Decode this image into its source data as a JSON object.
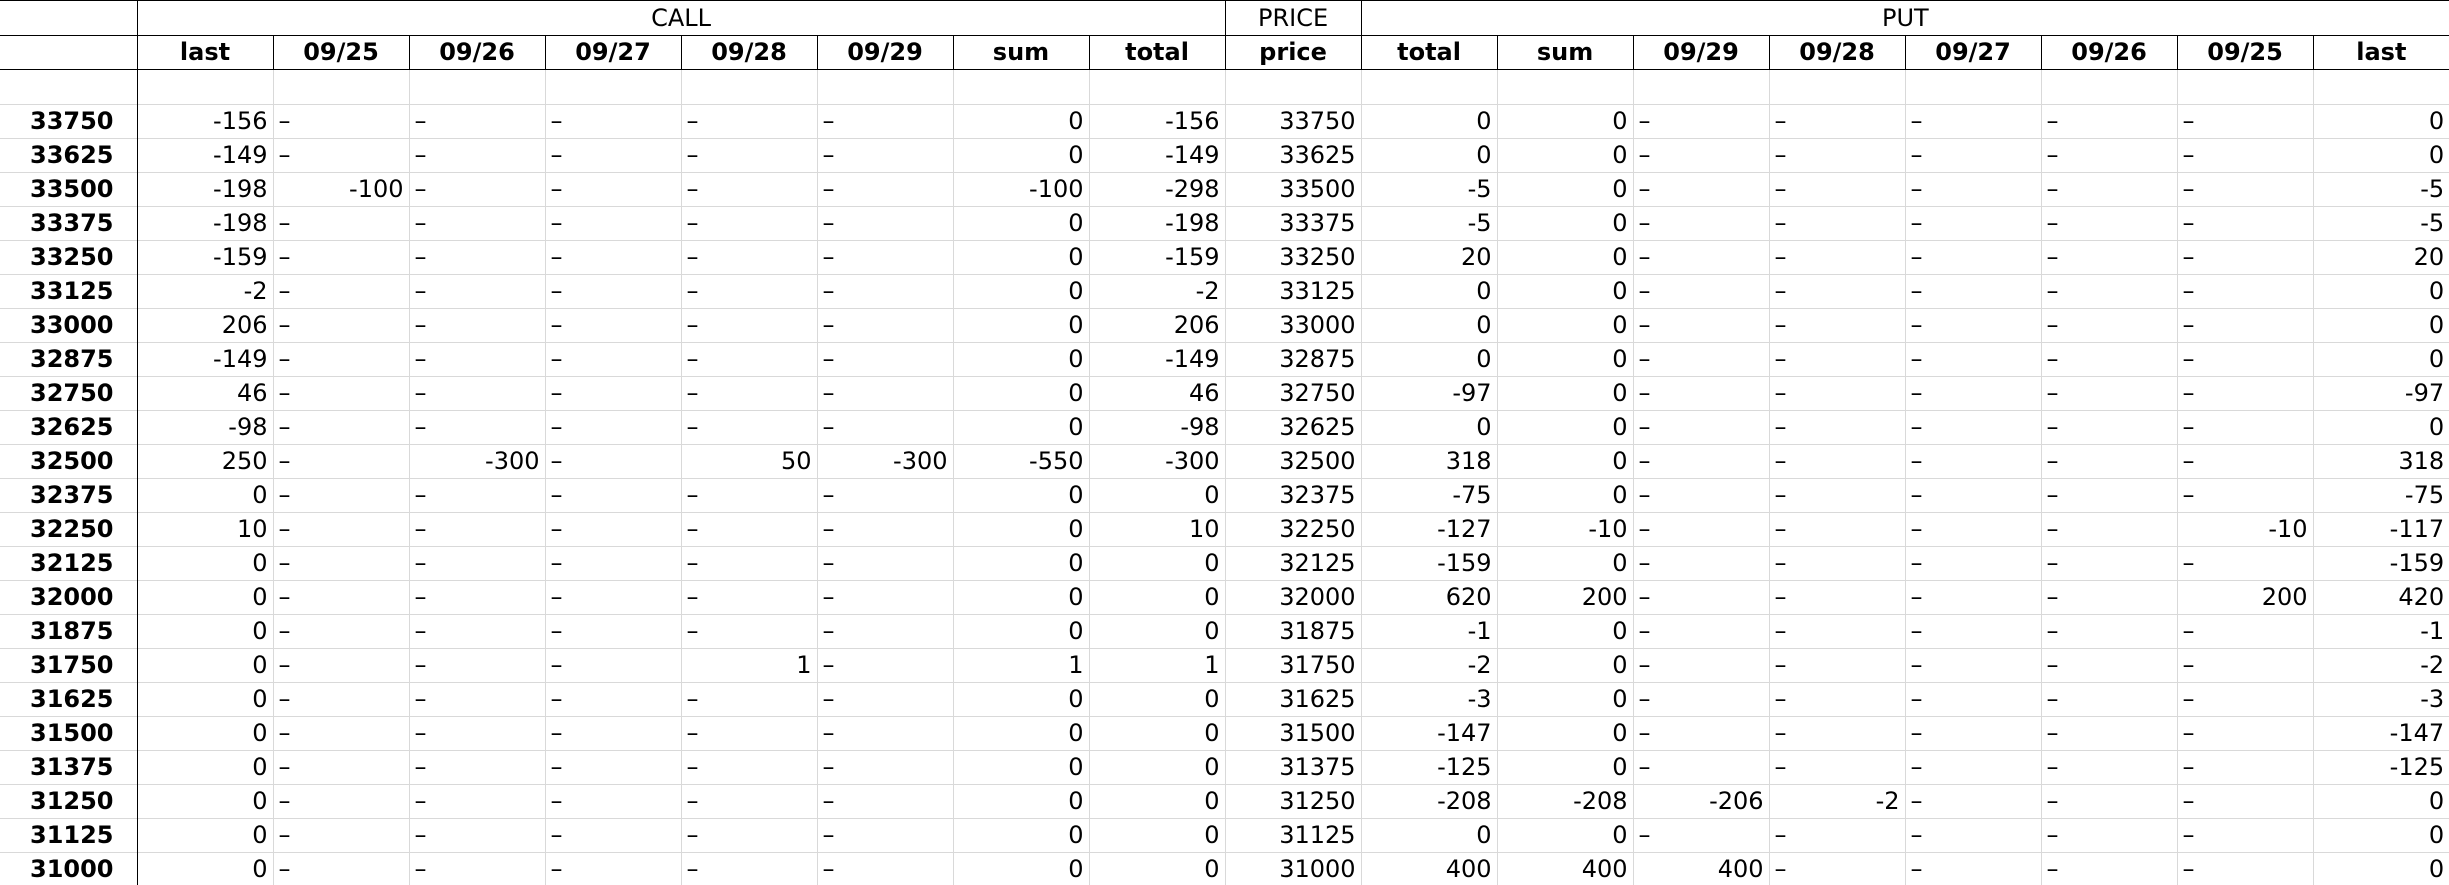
{
  "groups": {
    "call": "CALL",
    "price": "PRICE",
    "put": "PUT"
  },
  "headers": {
    "call": [
      "last",
      "09/25",
      "09/26",
      "09/27",
      "09/28",
      "09/29",
      "sum",
      "total"
    ],
    "price": "price",
    "put": [
      "total",
      "sum",
      "09/29",
      "09/28",
      "09/27",
      "09/26",
      "09/25",
      "last"
    ]
  },
  "rows": [
    {
      "label": "33750",
      "call": [
        "-156",
        "–",
        "–",
        "–",
        "–",
        "–",
        "0",
        "-156"
      ],
      "price": "33750",
      "put": [
        "0",
        "0",
        "–",
        "–",
        "–",
        "–",
        "–",
        "0"
      ]
    },
    {
      "label": "33625",
      "call": [
        "-149",
        "–",
        "–",
        "–",
        "–",
        "–",
        "0",
        "-149"
      ],
      "price": "33625",
      "put": [
        "0",
        "0",
        "–",
        "–",
        "–",
        "–",
        "–",
        "0"
      ]
    },
    {
      "label": "33500",
      "call": [
        "-198",
        "-100",
        "–",
        "–",
        "–",
        "–",
        "-100",
        "-298"
      ],
      "price": "33500",
      "put": [
        "-5",
        "0",
        "–",
        "–",
        "–",
        "–",
        "–",
        "-5"
      ]
    },
    {
      "label": "33375",
      "call": [
        "-198",
        "–",
        "–",
        "–",
        "–",
        "–",
        "0",
        "-198"
      ],
      "price": "33375",
      "put": [
        "-5",
        "0",
        "–",
        "–",
        "–",
        "–",
        "–",
        "-5"
      ]
    },
    {
      "label": "33250",
      "call": [
        "-159",
        "–",
        "–",
        "–",
        "–",
        "–",
        "0",
        "-159"
      ],
      "price": "33250",
      "put": [
        "20",
        "0",
        "–",
        "–",
        "–",
        "–",
        "–",
        "20"
      ]
    },
    {
      "label": "33125",
      "call": [
        "-2",
        "–",
        "–",
        "–",
        "–",
        "–",
        "0",
        "-2"
      ],
      "price": "33125",
      "put": [
        "0",
        "0",
        "–",
        "–",
        "–",
        "–",
        "–",
        "0"
      ]
    },
    {
      "label": "33000",
      "call": [
        "206",
        "–",
        "–",
        "–",
        "–",
        "–",
        "0",
        "206"
      ],
      "price": "33000",
      "put": [
        "0",
        "0",
        "–",
        "–",
        "–",
        "–",
        "–",
        "0"
      ]
    },
    {
      "label": "32875",
      "call": [
        "-149",
        "–",
        "–",
        "–",
        "–",
        "–",
        "0",
        "-149"
      ],
      "price": "32875",
      "put": [
        "0",
        "0",
        "–",
        "–",
        "–",
        "–",
        "–",
        "0"
      ]
    },
    {
      "label": "32750",
      "call": [
        "46",
        "–",
        "–",
        "–",
        "–",
        "–",
        "0",
        "46"
      ],
      "price": "32750",
      "put": [
        "-97",
        "0",
        "–",
        "–",
        "–",
        "–",
        "–",
        "-97"
      ]
    },
    {
      "label": "32625",
      "call": [
        "-98",
        "–",
        "–",
        "–",
        "–",
        "–",
        "0",
        "-98"
      ],
      "price": "32625",
      "put": [
        "0",
        "0",
        "–",
        "–",
        "–",
        "–",
        "–",
        "0"
      ]
    },
    {
      "label": "32500",
      "call": [
        "250",
        "–",
        "-300",
        "–",
        "50",
        "-300",
        "-550",
        "-300"
      ],
      "price": "32500",
      "put": [
        "318",
        "0",
        "–",
        "–",
        "–",
        "–",
        "–",
        "318"
      ]
    },
    {
      "label": "32375",
      "call": [
        "0",
        "–",
        "–",
        "–",
        "–",
        "–",
        "0",
        "0"
      ],
      "price": "32375",
      "put": [
        "-75",
        "0",
        "–",
        "–",
        "–",
        "–",
        "–",
        "-75"
      ]
    },
    {
      "label": "32250",
      "call": [
        "10",
        "–",
        "–",
        "–",
        "–",
        "–",
        "0",
        "10"
      ],
      "price": "32250",
      "put": [
        "-127",
        "-10",
        "–",
        "–",
        "–",
        "–",
        "-10",
        "-117"
      ]
    },
    {
      "label": "32125",
      "call": [
        "0",
        "–",
        "–",
        "–",
        "–",
        "–",
        "0",
        "0"
      ],
      "price": "32125",
      "put": [
        "-159",
        "0",
        "–",
        "–",
        "–",
        "–",
        "–",
        "-159"
      ]
    },
    {
      "label": "32000",
      "call": [
        "0",
        "–",
        "–",
        "–",
        "–",
        "–",
        "0",
        "0"
      ],
      "price": "32000",
      "put": [
        "620",
        "200",
        "–",
        "–",
        "–",
        "–",
        "200",
        "420"
      ]
    },
    {
      "label": "31875",
      "call": [
        "0",
        "–",
        "–",
        "–",
        "–",
        "–",
        "0",
        "0"
      ],
      "price": "31875",
      "put": [
        "-1",
        "0",
        "–",
        "–",
        "–",
        "–",
        "–",
        "-1"
      ]
    },
    {
      "label": "31750",
      "call": [
        "0",
        "–",
        "–",
        "–",
        "1",
        "–",
        "1",
        "1"
      ],
      "price": "31750",
      "put": [
        "-2",
        "0",
        "–",
        "–",
        "–",
        "–",
        "–",
        "-2"
      ]
    },
    {
      "label": "31625",
      "call": [
        "0",
        "–",
        "–",
        "–",
        "–",
        "–",
        "0",
        "0"
      ],
      "price": "31625",
      "put": [
        "-3",
        "0",
        "–",
        "–",
        "–",
        "–",
        "–",
        "-3"
      ]
    },
    {
      "label": "31500",
      "call": [
        "0",
        "–",
        "–",
        "–",
        "–",
        "–",
        "0",
        "0"
      ],
      "price": "31500",
      "put": [
        "-147",
        "0",
        "–",
        "–",
        "–",
        "–",
        "–",
        "-147"
      ]
    },
    {
      "label": "31375",
      "call": [
        "0",
        "–",
        "–",
        "–",
        "–",
        "–",
        "0",
        "0"
      ],
      "price": "31375",
      "put": [
        "-125",
        "0",
        "–",
        "–",
        "–",
        "–",
        "–",
        "-125"
      ]
    },
    {
      "label": "31250",
      "call": [
        "0",
        "–",
        "–",
        "–",
        "–",
        "–",
        "0",
        "0"
      ],
      "price": "31250",
      "put": [
        "-208",
        "-208",
        "-206",
        "-2",
        "–",
        "–",
        "–",
        "0"
      ]
    },
    {
      "label": "31125",
      "call": [
        "0",
        "–",
        "–",
        "–",
        "–",
        "–",
        "0",
        "0"
      ],
      "price": "31125",
      "put": [
        "0",
        "0",
        "–",
        "–",
        "–",
        "–",
        "–",
        "0"
      ]
    },
    {
      "label": "31000",
      "call": [
        "0",
        "–",
        "–",
        "–",
        "–",
        "–",
        "0",
        "0"
      ],
      "price": "31000",
      "put": [
        "400",
        "400",
        "400",
        "–",
        "–",
        "–",
        "–",
        "0"
      ]
    }
  ]
}
